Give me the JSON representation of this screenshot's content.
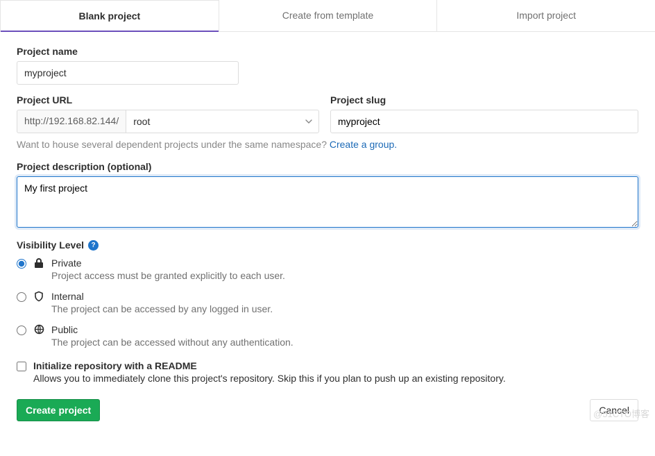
{
  "tabs": {
    "blank": "Blank project",
    "template": "Create from template",
    "import": "Import project"
  },
  "projectName": {
    "label": "Project name",
    "value": "myproject"
  },
  "projectUrl": {
    "label": "Project URL",
    "base": "http://192.168.82.144/",
    "namespace": "root"
  },
  "projectSlug": {
    "label": "Project slug",
    "value": "myproject"
  },
  "namespaceHint": {
    "text": "Want to house several dependent projects under the same namespace? ",
    "link": "Create a group."
  },
  "description": {
    "label": "Project description (optional)",
    "value": "My first project "
  },
  "visibility": {
    "label": "Visibility Level",
    "options": {
      "private": {
        "title": "Private",
        "desc": "Project access must be granted explicitly to each user."
      },
      "internal": {
        "title": "Internal",
        "desc": "The project can be accessed by any logged in user."
      },
      "public": {
        "title": "Public",
        "desc": "The project can be accessed without any authentication."
      }
    }
  },
  "readme": {
    "title": "Initialize repository with a README",
    "desc": "Allows you to immediately clone this project's repository. Skip this if you plan to push up an existing repository."
  },
  "buttons": {
    "create": "Create project",
    "cancel": "Cancel"
  },
  "watermark": "@51CTO博客"
}
